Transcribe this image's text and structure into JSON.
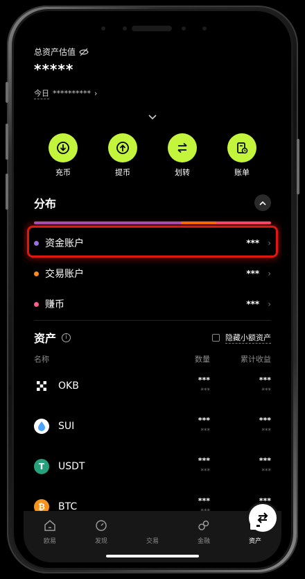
{
  "header": {
    "total_label": "总资产估值",
    "total_value": "*****",
    "today_label": "今日",
    "today_value": "**********"
  },
  "actions": [
    {
      "label": "充币",
      "icon": "deposit-icon"
    },
    {
      "label": "提币",
      "icon": "withdraw-icon"
    },
    {
      "label": "划转",
      "icon": "transfer-icon"
    },
    {
      "label": "账单",
      "icon": "bill-icon"
    }
  ],
  "distribution": {
    "title": "分布",
    "bar_segments": [
      {
        "color": "#9b59d6",
        "share": 0.62
      },
      {
        "color": "#ff7a00",
        "share": 0.15
      },
      {
        "color": "#ff4f7b",
        "share": 0.23
      }
    ],
    "accounts": [
      {
        "name": "资金账户",
        "value": "***",
        "color": "#9b6ee0"
      },
      {
        "name": "交易账户",
        "value": "***",
        "color": "#ff8a1a"
      },
      {
        "name": "赚币",
        "value": "***",
        "color": "#ff5c8a"
      }
    ]
  },
  "assets": {
    "title": "资产",
    "hide_small_label": "隐藏小额资产",
    "col_name": "名称",
    "col_qty": "数量",
    "col_pnl": "累计收益",
    "items": [
      {
        "name": "OKB",
        "qty": "***",
        "qty_sub": "***",
        "pnl": "***",
        "pnl_sub": "***",
        "icon_color": "#000000",
        "icon": "okb-icon"
      },
      {
        "name": "SUI",
        "qty": "***",
        "qty_sub": "***",
        "pnl": "***",
        "pnl_sub": "***",
        "icon_color": "#ffffff",
        "icon": "sui-icon"
      },
      {
        "name": "USDT",
        "qty": "***",
        "qty_sub": "***",
        "pnl": "***",
        "pnl_sub": "***",
        "icon_color": "#26a17b",
        "icon": "usdt-icon"
      },
      {
        "name": "BTC",
        "qty": "***",
        "qty_sub": "***",
        "pnl": "***",
        "pnl_sub": "***",
        "icon_color": "#f7931a",
        "icon": "btc-icon"
      }
    ]
  },
  "tabbar": {
    "items": [
      {
        "label": "欧易",
        "icon": "home-icon"
      },
      {
        "label": "发现",
        "icon": "discover-icon"
      },
      {
        "label": "交易",
        "icon": "trade-icon"
      },
      {
        "label": "金融",
        "icon": "finance-icon"
      },
      {
        "label": "资产",
        "icon": "wallet-icon",
        "active": true
      }
    ]
  },
  "colors": {
    "accent": "#c3f53c",
    "highlight": "#e0170e"
  }
}
